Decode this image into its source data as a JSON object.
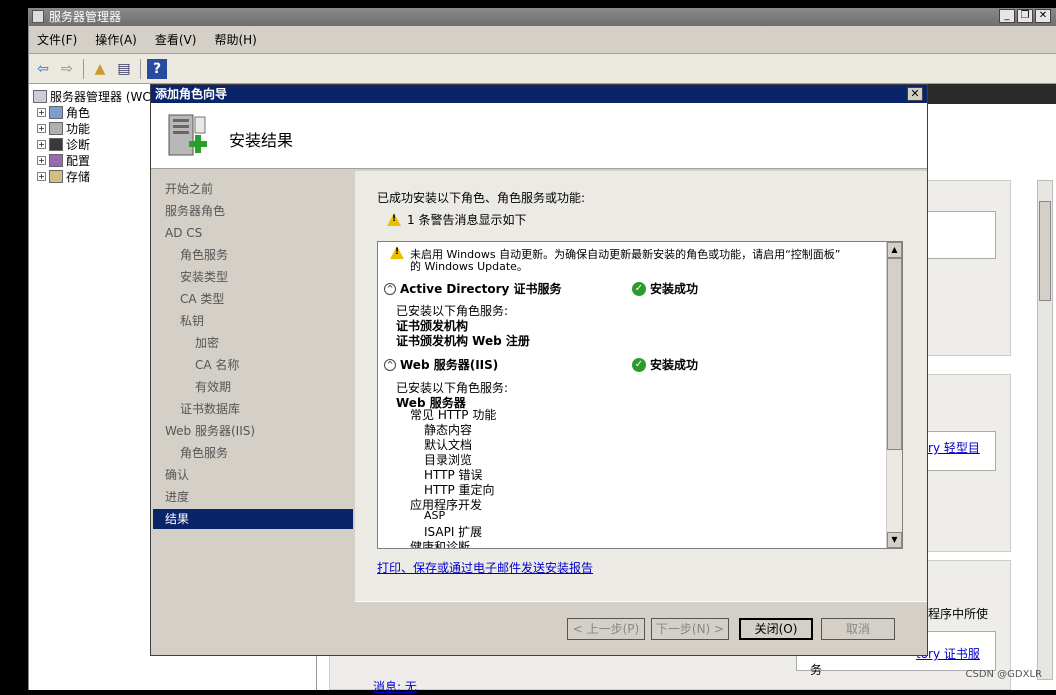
{
  "main_window": {
    "title": "服务器管理器",
    "min_label": "_",
    "max_label": "❐",
    "close_label": "✕"
  },
  "menu": [
    "文件(F)",
    "操作(A)",
    "查看(V)",
    "帮助(H)"
  ],
  "tree": {
    "root": "服务器管理器 (WC",
    "items": [
      "角色",
      "功能",
      "诊断",
      "配置",
      "存储"
    ]
  },
  "right_pane": {
    "text1": "tory 轻型目",
    "text2": "用程序中所使",
    "text3": "tory 证书服",
    "text4": "务",
    "text5": "消息: 无"
  },
  "wizard": {
    "title": "添加角色向导",
    "close_label": "✕",
    "header_title": "安装结果",
    "nav": [
      {
        "label": "开始之前",
        "level": 0
      },
      {
        "label": "服务器角色",
        "level": 0
      },
      {
        "label": "AD CS",
        "level": 0
      },
      {
        "label": "角色服务",
        "level": 1
      },
      {
        "label": "安装类型",
        "level": 1
      },
      {
        "label": "CA 类型",
        "level": 1
      },
      {
        "label": "私钥",
        "level": 1
      },
      {
        "label": "加密",
        "level": 2
      },
      {
        "label": "CA 名称",
        "level": 2
      },
      {
        "label": "有效期",
        "level": 2
      },
      {
        "label": "证书数据库",
        "level": 1
      },
      {
        "label": "Web 服务器(IIS)",
        "level": 0
      },
      {
        "label": "角色服务",
        "level": 1
      },
      {
        "label": "确认",
        "level": 0
      },
      {
        "label": "进度",
        "level": 0
      },
      {
        "label": "结果",
        "level": 0
      }
    ],
    "selected_nav": "结果",
    "summary": "已成功安装以下角色、角色服务或功能:",
    "warning_count": "1 条警告消息显示如下",
    "list": {
      "warning_line1": "未启用 Windows 自动更新。为确保自动更新最新安装的角色或功能，请启用“控制面板”",
      "warning_line2": "的 Windows Update。",
      "section1_title": "Active Directory 证书服务",
      "section1_status": "安装成功",
      "section1_installed": "已安装以下角色服务:",
      "section1_items": [
        "证书颁发机构",
        "证书颁发机构 Web 注册"
      ],
      "section2_title": "Web 服务器(IIS)",
      "section2_status": "安装成功",
      "section2_installed": "已安装以下角色服务:",
      "section2_web_server": "Web 服务器",
      "section2_common_http": "常见 HTTP 功能",
      "section2_common_items": [
        "静态内容",
        "默认文档",
        "目录浏览",
        "HTTP 错误",
        "HTTP 重定向"
      ],
      "section2_app_dev": "应用程序开发",
      "section2_app_items": [
        "ASP",
        "ISAPI 扩展"
      ],
      "section2_health": "健康和诊断"
    },
    "report_link": "打印、保存或通过电子邮件发送安装报告",
    "buttons": {
      "prev": "< 上一步(P)",
      "next": "下一步(N) >",
      "close": "关闭(O)",
      "cancel": "取消"
    }
  },
  "watermark": "CSDN @GDXLR"
}
